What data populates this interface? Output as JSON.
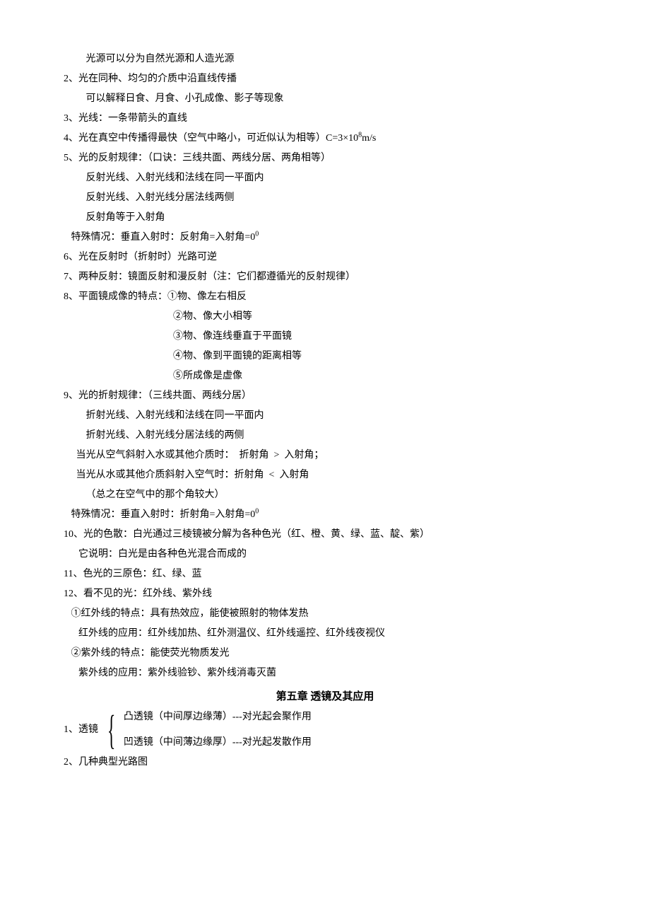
{
  "lines": {
    "l0": "         光源可以分为自然光源和人造光源",
    "l1": "2、光在同种、均匀的介质中沿直线传播",
    "l2": "         可以解释日食、月食、小孔成像、影子等现象",
    "l3": "3、光线：一条带箭头的直线",
    "l4a": "4、光在真空中传播得最快（空气中略小，可近似认为相等）C=3×10",
    "l4b": "m/s",
    "l5": "5、光的反射规律：（口诀：三线共面、两线分居、两角相等）",
    "l6": "         反射光线、入射光线和法线在同一平面内",
    "l7": "         反射光线、入射光线分居法线两侧",
    "l8": "         反射角等于入射角",
    "l9a": "   特殊情况：垂直入射时：反射角=入射角=0",
    "l10": "6、光在反射时（折射时）光路可逆",
    "l11": "7、两种反射：镜面反射和漫反射（注：它们都遵循光的反射规律）",
    "l12": "8、平面镜成像的特点：①物、像左右相反",
    "l13": "②物、像大小相等",
    "l14": "③物、像连线垂直于平面镜",
    "l15": "④物、像到平面镜的距离相等",
    "l16": "⑤所成像是虚像",
    "l17": "9、光的折射规律：（三线共面、两线分居）",
    "l18": "         折射光线、入射光线和法线在同一平面内",
    "l19": "         折射光线、入射光线分居法线的两侧",
    "l20": "     当光从空气斜射入水或其他介质时：  折射角  >  入射角；",
    "l21": "     当光从水或其他介质斜射入空气时：折射角  <  入射角",
    "l22": "         （总之在空气中的那个角较大）",
    "l23a": "   特殊情况：垂直入射时：折射角=入射角=0",
    "l24": "10、光的色散：白光通过三棱镜被分解为各种色光（红、橙、黄、绿、蓝、靛、紫）",
    "l25": "      它说明：白光是由各种色光混合而成的",
    "l26": "11、色光的三原色：红、绿、蓝",
    "l27": "12、看不见的光：红外线、紫外线",
    "l28": "   ①红外线的特点：具有热效应，能使被照射的物体发热",
    "l29": "      红外线的应用：红外线加热、红外测温仪、红外线遥控、红外线夜视仪",
    "l30": "   ②紫外线的特点：能使荧光物质发光",
    "l31": "      紫外线的应用：紫外线验钞、紫外线消毒灭菌",
    "title": "第五章    透镜及其应用",
    "lens_label": "1、透镜",
    "lens_a": "凸透镜（中间厚边缘薄）---对光起会聚作用",
    "lens_b": "凹透镜（中间薄边缘厚）---对光起发散作用",
    "l32": "2、几种典型光路图",
    "sup8": "8",
    "sup0": "0"
  }
}
